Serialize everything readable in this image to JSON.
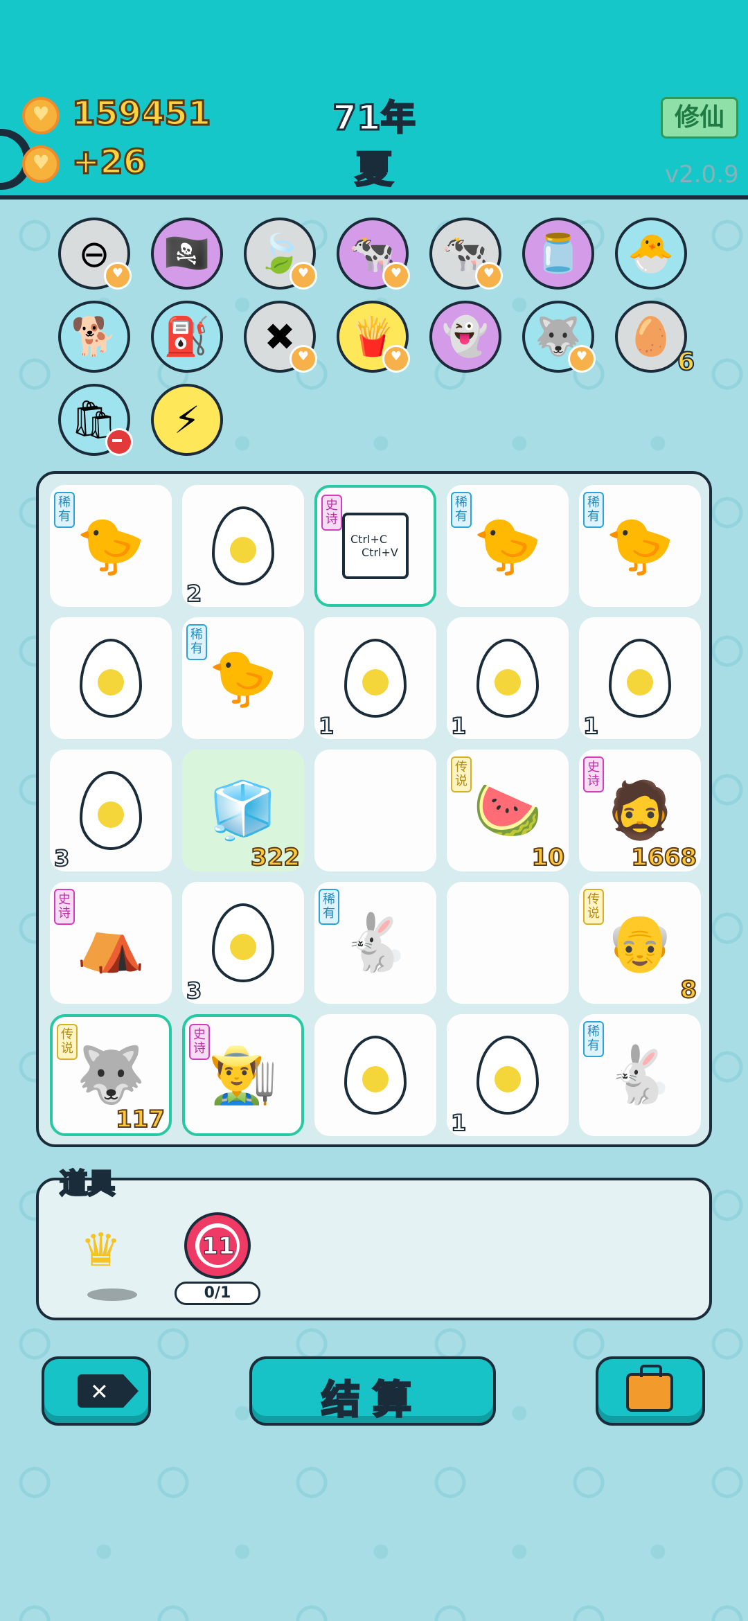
{
  "header": {
    "coins": "159451",
    "income": "+26",
    "year": "71年",
    "season": "夏",
    "mode_button": "修仙",
    "version": "v2.0.9"
  },
  "items_row": [
    {
      "icon": "minus-circle-icon",
      "emoji": "⊖",
      "color": "#d8dcdc"
    },
    {
      "icon": "eyepatch-icon",
      "emoji": "🏴‍☠️",
      "color": "#d49be8"
    },
    {
      "icon": "leaf-icon",
      "emoji": "🍃",
      "color": "#d8dcdc"
    },
    {
      "icon": "cow-pair-icon",
      "emoji": "🐄",
      "color": "#d49be8"
    },
    {
      "icon": "cow-pair-icon",
      "emoji": "🐄",
      "color": "#d8dcdc"
    },
    {
      "icon": "milk-jar-icon",
      "emoji": "🫙",
      "color": "#d49be8"
    },
    {
      "icon": "chick-egg-icon",
      "emoji": "🐣",
      "color": "#9fe3ef"
    },
    {
      "icon": "dog-icon",
      "emoji": "🐕",
      "color": "#9fe3ef"
    },
    {
      "icon": "pump-icon",
      "emoji": "⛽",
      "color": "#9fe3ef"
    },
    {
      "icon": "delete-tag-icon",
      "emoji": "✖",
      "color": "#d8dcdc"
    },
    {
      "icon": "fries-icon",
      "emoji": "🍟",
      "color": "#ffe75a"
    },
    {
      "icon": "ghost-icon",
      "emoji": "👻",
      "color": "#d49be8"
    },
    {
      "icon": "husky-icon",
      "emoji": "🐺",
      "color": "#9fe3ef"
    },
    {
      "icon": "egg-tray-icon",
      "emoji": "🥚",
      "color": "#d8dcdc",
      "count": "6"
    },
    {
      "icon": "bag-icon",
      "emoji": "🛍",
      "color": "#9fe3ef"
    },
    {
      "icon": "lightning-icon",
      "emoji": "⚡",
      "color": "#ffe75a"
    }
  ],
  "tags": {
    "rare": "稀有",
    "epic": "史诗",
    "legend": "传说"
  },
  "grid": [
    {
      "kind": "chicken",
      "tag": "rare"
    },
    {
      "kind": "egg",
      "left": "2"
    },
    {
      "kind": "copy",
      "tag": "epic",
      "hl": true,
      "line1": "Ctrl+C",
      "line2": "Ctrl+V"
    },
    {
      "kind": "chicken",
      "tag": "rare"
    },
    {
      "kind": "chicken",
      "tag": "rare"
    },
    {
      "kind": "egg"
    },
    {
      "kind": "chicken",
      "tag": "rare"
    },
    {
      "kind": "egg",
      "left": "1"
    },
    {
      "kind": "egg",
      "left": "1"
    },
    {
      "kind": "egg",
      "left": "1"
    },
    {
      "kind": "egg",
      "left": "3"
    },
    {
      "kind": "fridge",
      "right": "322",
      "green": true
    },
    {
      "kind": "empty"
    },
    {
      "kind": "watermelon",
      "tag": "legend",
      "right": "10"
    },
    {
      "kind": "oldman",
      "tag": "epic",
      "right": "1668"
    },
    {
      "kind": "tent",
      "tag": "epic"
    },
    {
      "kind": "egg",
      "left": "3"
    },
    {
      "kind": "rabbit",
      "tag": "rare"
    },
    {
      "kind": "empty"
    },
    {
      "kind": "grandpa",
      "tag": "legend",
      "right": "8"
    },
    {
      "kind": "husky",
      "tag": "legend",
      "right": "117",
      "hl": true
    },
    {
      "kind": "farmer",
      "tag": "epic",
      "hl": true
    },
    {
      "kind": "egg"
    },
    {
      "kind": "egg",
      "left": "1"
    },
    {
      "kind": "rabbit",
      "tag": "rare"
    }
  ],
  "tools": {
    "label": "道具",
    "timer_value": "11",
    "timer_progress": "0/1"
  },
  "buttons": {
    "settle": "结算"
  }
}
